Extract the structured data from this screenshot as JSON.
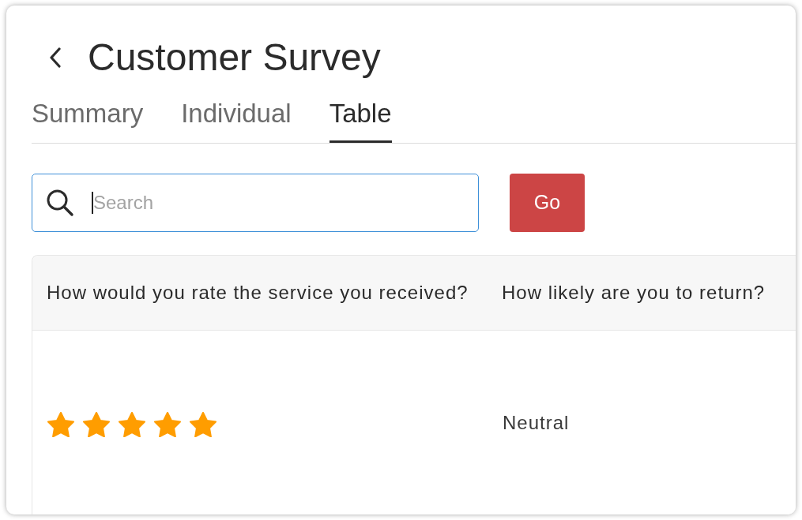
{
  "header": {
    "title": "Customer Survey"
  },
  "tabs": [
    {
      "label": "Summary",
      "selected": false
    },
    {
      "label": "Individual",
      "selected": false
    },
    {
      "label": "Table",
      "selected": true
    }
  ],
  "search": {
    "placeholder": "Search",
    "focused": true
  },
  "go_button": {
    "label": "Go"
  },
  "table": {
    "columns": [
      "How would you rate the service you received?",
      "How likely are you to return?"
    ],
    "rows": [
      {
        "cells": [
          {
            "kind": "stars",
            "stars": 5
          },
          {
            "kind": "text",
            "text": "Neutral"
          }
        ]
      }
    ]
  }
}
